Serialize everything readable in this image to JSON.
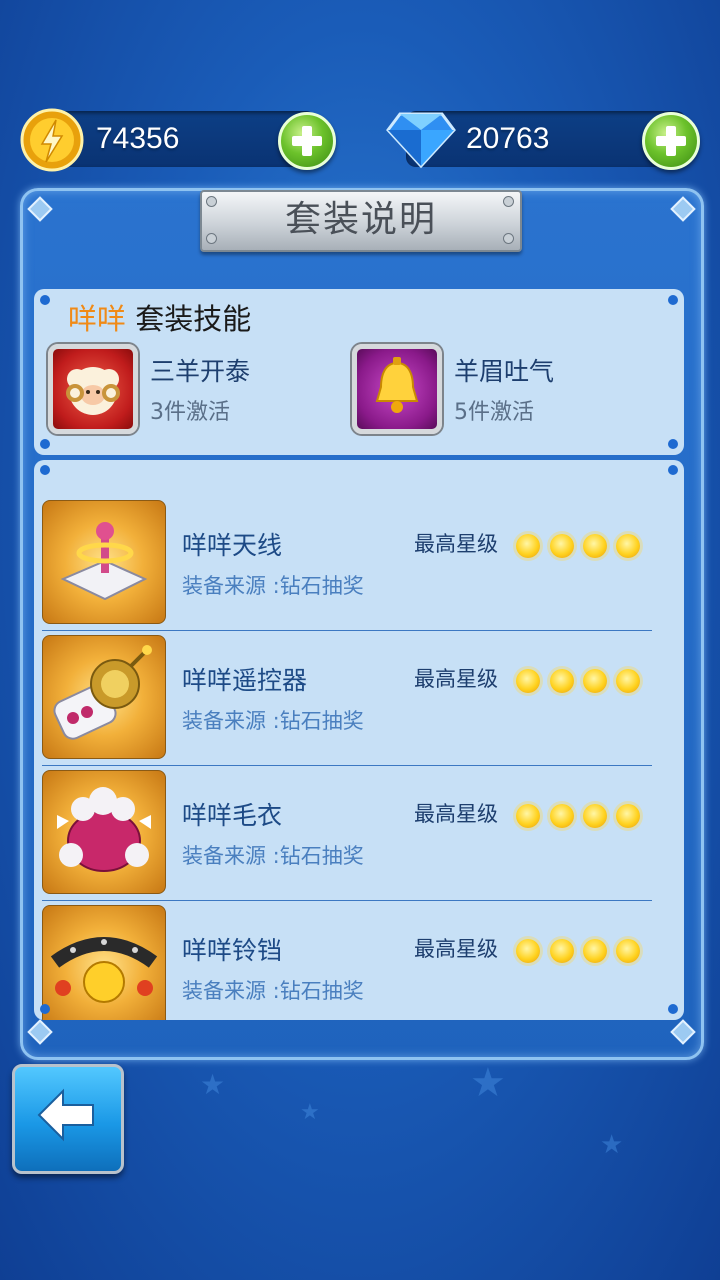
{
  "header": {
    "gold": "74356",
    "diamonds": "20763"
  },
  "panel": {
    "title": "套装说明"
  },
  "suit": {
    "name": "咩咩",
    "heading_suffix": "套装技能",
    "skills": [
      {
        "name": "三羊开泰",
        "condition": "3件激活",
        "icon": "sheep-skill-icon"
      },
      {
        "name": "羊眉吐气",
        "condition": "5件激活",
        "icon": "bell-skill-icon"
      }
    ]
  },
  "items": [
    {
      "name": "咩咩天线",
      "source": "装备来源 :钻石抽奖",
      "star_label": "最高星级",
      "stars": 4,
      "icon": "antenna-icon"
    },
    {
      "name": "咩咩遥控器",
      "source": "装备来源 :钻石抽奖",
      "star_label": "最高星级",
      "stars": 4,
      "icon": "remote-control-icon"
    },
    {
      "name": "咩咩毛衣",
      "source": "装备来源 :钻石抽奖",
      "star_label": "最高星级",
      "stars": 4,
      "icon": "sweater-icon"
    },
    {
      "name": "咩咩铃铛",
      "source": "装备来源 :钻石抽奖",
      "star_label": "最高星级",
      "stars": 4,
      "icon": "bell-collar-icon"
    }
  ],
  "colors": {
    "suit_name": "#f08a16",
    "panel_bg": "#c7e0f6",
    "background": "#1a5cb8"
  }
}
